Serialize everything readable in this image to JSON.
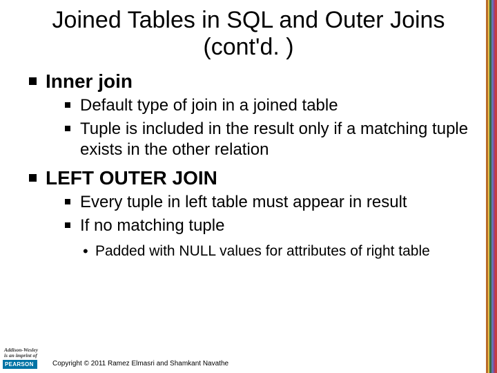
{
  "title": "Joined Tables in SQL and Outer Joins (cont'd. )",
  "sections": [
    {
      "heading": "Inner join",
      "points": [
        "Default type of join in a joined table",
        "Tuple is included in the result only if a matching tuple exists in the other relation"
      ]
    },
    {
      "heading": "LEFT OUTER JOIN",
      "points": [
        "Every tuple in left table must appear in result",
        "If no matching tuple"
      ],
      "subpoints_of_last": [
        "Padded with NULL values for attributes of right table"
      ]
    }
  ],
  "footer": {
    "publisher_line1": "Addison-Wesley",
    "publisher_line2": "is an imprint of",
    "brand": "PEARSON",
    "copyright": "Copyright © 2011 Ramez Elmasri and Shamkant Navathe"
  },
  "sidebar_colors": [
    "#b96b2a",
    "#e6c24a",
    "#3a6b3e",
    "#6673b5",
    "#a23c7a",
    "#c43e3e"
  ]
}
